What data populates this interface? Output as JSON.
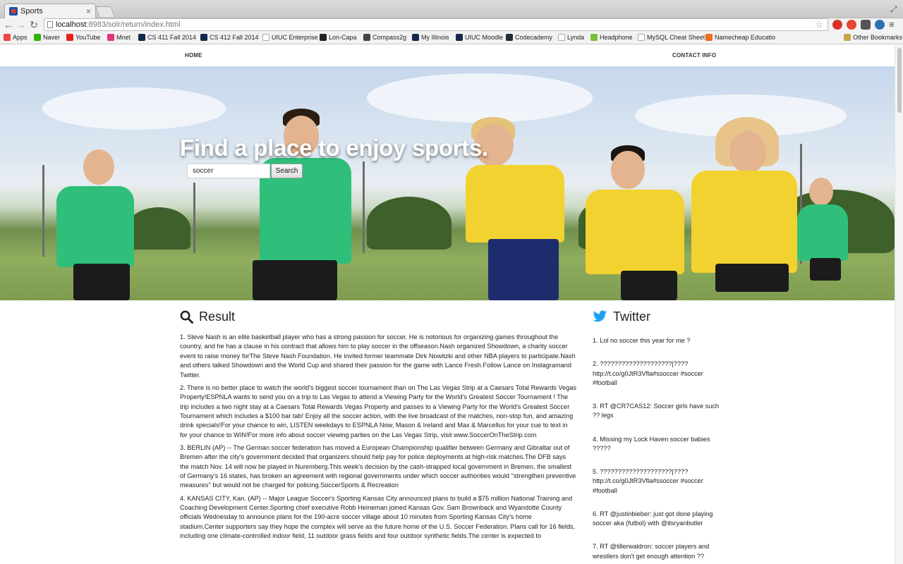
{
  "browser": {
    "tab_title": "Sports",
    "url_host": "localhost",
    "url_path": ":8983/solr/return/index.html",
    "bookmarks": [
      "Apps",
      "Naver",
      "YouTube",
      "Mnet",
      "CS 411 Fall 2014",
      "CS 412 Fall 2014",
      "UIUC Enterprise",
      "Lon-Capa",
      "Compass2g",
      "My Illinois",
      "UIUC Moodle",
      "Codecademy",
      "Lynda",
      "Headphone",
      "MySQL Cheat Sheet",
      "Namecheap Educatio"
    ],
    "other_bookmarks": "Other Bookmarks"
  },
  "site_nav": {
    "home": "HOME",
    "contact": "CONTACT INFO"
  },
  "hero": {
    "title": "Find a place to enjoy sports.",
    "search_value": "soccer",
    "search_button": "Search"
  },
  "result": {
    "heading": "Result",
    "items": [
      "1. Steve Nash is an elite basketball player who has a strong passion for soccer. He is notorious for organizing games throughout the country, and he has a clause in his contract that allows him to play soccer in the offseason.Nash organized Showdown, a charity soccer event to raise money forThe Steve Nash Foundation. He invited former teammate Dirk Nowitzki and other NBA players to participate.Nash and others talked Showdown and the World Cup and shared their passion for the game with Lance Fresh.Follow Lance on Instagramand Twitter.",
      "2. There is no better place to watch the world's biggest soccer tournament than on The Las Vegas Strip at a Caesars Total Rewards Vegas Property!ESPNLA wants to send you on a trip to Las Vegas to attend a Viewing Party for the World's Greatest Soccer Tournament ! The trip includes a two night stay at a Caesars Total Rewards Vegas Property and passes to a Viewing Party for the World's Greatest Soccer Tournament which includes a $100 bar tab! Enjoy all the soccer action, with the live broadcast of the matches, non-stop fun, and amazing drink specials!For your chance to win, LISTEN weekdays to ESPNLA Now, Mason & Ireland and Max & Marcellus for your cue to text in for your chance to WIN!For more info about soccer viewing parties on the Las Vegas Strip, visit www.SoccerOnTheStrip.com",
      "3. BERLIN (AP) -- The German soccer federation has moved a European Championship qualifier between Germany and Gibraltar out of Bremen after the city's government decided that organizers should help pay for police deployments at high-risk matches.The DFB says the match Nov. 14 will now be played in Nuremberg.This week's decision by the cash-strapped local government in Bremen, the smallest of Germany's 16 states, has broken an agreement with regional governments under which soccer authorities would ''strengthen preventive measures'' but would not be charged for policing.SoccerSports & Recreation",
      "4. KANSAS CITY, Kan. (AP) -- Major League Soccer's Sporting Kansas City announced plans to build a $75 million National Training and Coaching Development Center.Sporting chief executive Robb Heineman joined Kansas Gov. Sam Brownback and Wyandotte County officials Wednesday to announce plans for the 190-acre soccer village about 10 minutes from Sporting Kansas City's home stadium.Center supporters say they hope the complex will serve as the future home of the U.S. Soccer Federation. Plans call for 16 fields, including one climate-controlled indoor field, 11 outdoor grass fields and four outdoor synthetic fields.The center is expected to"
    ]
  },
  "twitter": {
    "heading": "Twitter",
    "tweets": [
      "1. Lol no soccer this year for me ?",
      "2. ????????????????????|???? http://t.co/g0JtR3Vfla#ssoccer #soccer #football",
      "3. RT @CR7CAS12: Soccer girls have such ?? legs",
      "4. Missing my Lock Haven soccer babies ?????",
      "5. ????????????????????|???? http://t.co/g0JtR3Vfla#ssoccer #soccer #football",
      "6. RT @justinbieber: just got done playing soccer aka (futbol) with @itsryanbutler",
      "7. RT @tillerwaldron: soccer players and wrestlers don't get enough attention ??"
    ]
  },
  "colors": {
    "twitter_blue": "#1da1f2",
    "green_jersey": "#2fbf7a",
    "yellow_jersey": "#f2d230"
  }
}
